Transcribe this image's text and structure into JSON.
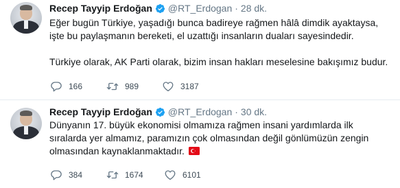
{
  "tweets": [
    {
      "author_name": "Recep Tayyip Erdoğan",
      "handle": "@RT_Erdogan",
      "separator": "·",
      "time": "28 dk.",
      "paragraphs": [
        "Eğer bugün Türkiye, yaşadığı bunca badireye rağmen hâlâ dimdik ayaktaysa, işte bu paylaşmanın bereketi, el uzattığı insanların duaları sayesindedir.",
        "Türkiye olarak, AK Parti olarak, bizim insan hakları meselesine bakışımız budur."
      ],
      "replies": "166",
      "retweets": "989",
      "likes": "3187"
    },
    {
      "author_name": "Recep Tayyip Erdoğan",
      "handle": "@RT_Erdogan",
      "separator": "·",
      "time": "30 dk.",
      "paragraphs": [
        "Dünyanın 17. büyük ekonomisi olmamıza rağmen insani yardımlarda ilk sıralarda yer almamız, paramızın çok olmasından değil gönlümüzün zengin olmasından kaynaklanmaktadır."
      ],
      "replies": "384",
      "retweets": "1674",
      "likes": "6101"
    }
  ],
  "icons": {
    "verified": "verified-badge-icon",
    "reply": "reply-icon",
    "retweet": "retweet-icon",
    "like": "heart-icon",
    "flag": "turkey-flag-icon"
  },
  "colors": {
    "verified": "#1da1f2",
    "muted": "#657786",
    "flag_red": "#e30a17"
  }
}
